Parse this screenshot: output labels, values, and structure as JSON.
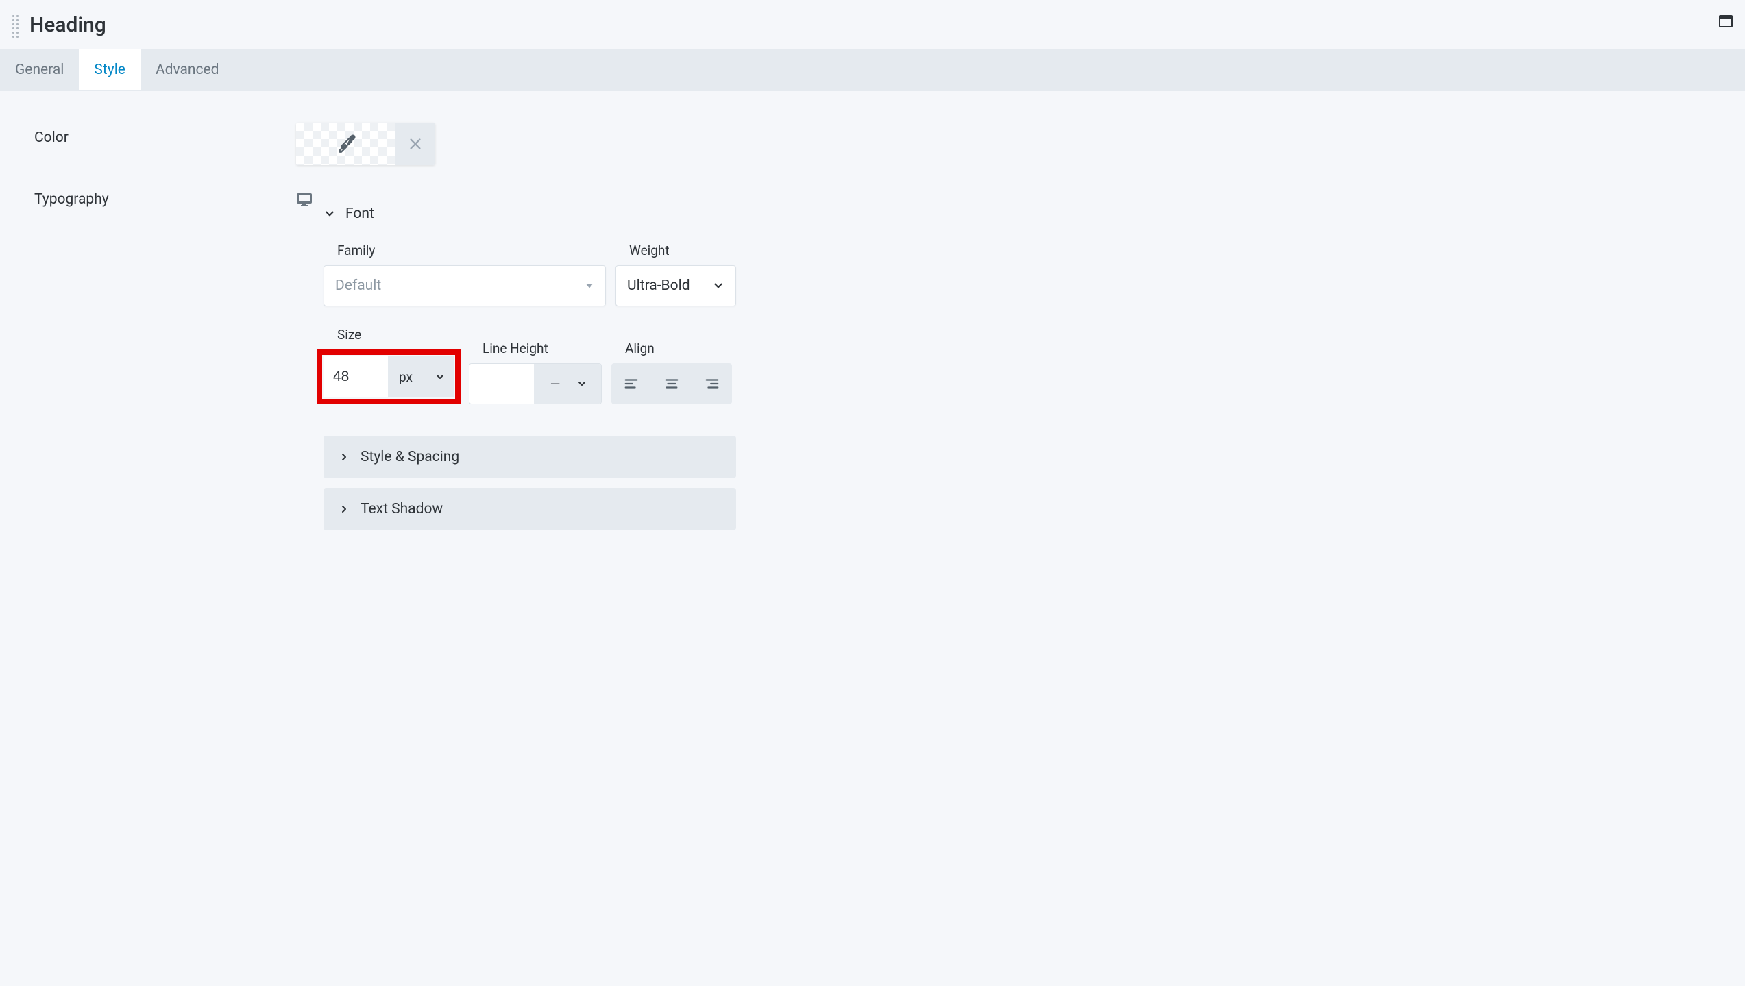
{
  "header": {
    "title": "Heading"
  },
  "tabs": {
    "general": "General",
    "style": "Style",
    "advanced": "Advanced"
  },
  "labels": {
    "color": "Color",
    "typography": "Typography"
  },
  "typography": {
    "font_section": "Font",
    "family_label": "Family",
    "family_value": "Default",
    "weight_label": "Weight",
    "weight_value": "Ultra-Bold",
    "size_label": "Size",
    "size_value": "48",
    "size_unit": "px",
    "lineheight_label": "Line Height",
    "lineheight_value": "",
    "lineheight_unit": "—",
    "align_label": "Align",
    "style_spacing": "Style & Spacing",
    "text_shadow": "Text Shadow"
  }
}
